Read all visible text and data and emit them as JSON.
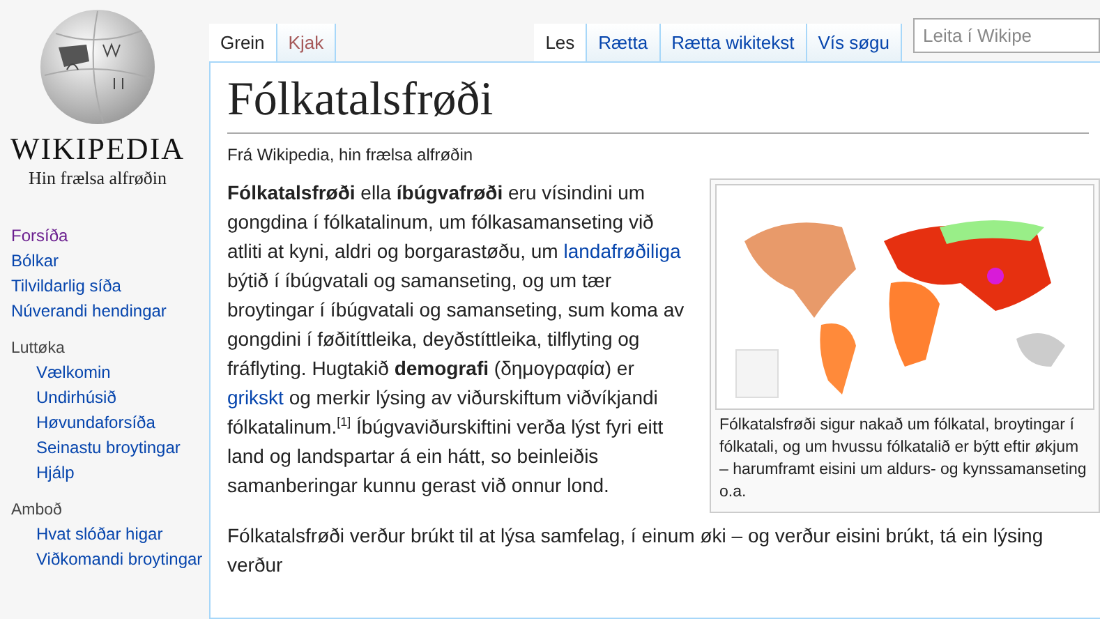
{
  "logo": {
    "wordmark": "WIKIPEDIA",
    "tagline": "Hin frælsa alfrøðin"
  },
  "sidebar": {
    "items": [
      {
        "label": "Forsíða",
        "visited": true
      },
      {
        "label": "Bólkar",
        "visited": false
      },
      {
        "label": "Tilvildarlig síða",
        "visited": false
      },
      {
        "label": "Núverandi hendingar",
        "visited": false
      }
    ],
    "sections": [
      {
        "heading": "Luttøka",
        "items": [
          {
            "label": "Vælkomin",
            "visited": false
          },
          {
            "label": "Undirhúsið",
            "visited": false
          },
          {
            "label": "Høvundaforsíða",
            "visited": false
          },
          {
            "label": "Seinastu broytingar",
            "visited": false
          },
          {
            "label": "Hjálp",
            "visited": false
          }
        ]
      },
      {
        "heading": "Amboð",
        "items": [
          {
            "label": "Hvat slóðar higar",
            "visited": false
          },
          {
            "label": "Viðkomandi broytingar",
            "visited": false
          }
        ]
      }
    ]
  },
  "tabs_left": [
    {
      "label": "Grein",
      "selected": true,
      "missing": false
    },
    {
      "label": "Kjak",
      "selected": false,
      "missing": true
    }
  ],
  "tabs_right": [
    {
      "label": "Les",
      "selected": true
    },
    {
      "label": "Rætta",
      "selected": false
    },
    {
      "label": "Rætta wikitekst",
      "selected": false
    },
    {
      "label": "Vís søgu",
      "selected": false
    }
  ],
  "search": {
    "placeholder": "Leita í Wikipe"
  },
  "article": {
    "title": "Fólkatalsfrøði",
    "subtitle": "Frá Wikipedia, hin frælsa alfrøðin",
    "intro": [
      {
        "kind": "text",
        "text": "**Fólkatalsfrøði** ella **íbúgvafrøði** eru vísindini um gongdina í fólkatalinum, um fólkasamanseting við atliti at kyni, aldri og borgarastøðu, um "
      },
      {
        "kind": "link",
        "text": "landafrøðiliga"
      },
      {
        "kind": "text",
        "text": " býtið í íbúgvatali og samanseting, og um tær broytingar í íbúgvatali og samanseting, sum koma av gongdini í føðitíttleika, deyðstíttleika, tilflyting og fráflyting. Hugtakið **demografi** (δημογραφία) er "
      },
      {
        "kind": "link",
        "text": "grikskt"
      },
      {
        "kind": "text",
        "text": " og merkir lýsing av viðurskiftum viðvíkjandi fólkatalinum.$^{[1]}$ Íbúgvaviðurskiftini verða lýst fyri eitt land og landspartar á ein hátt, so beinleiðis samanberingar kunnu gerast við onnur lond."
      }
    ],
    "paragraph_2": "Fólkatalsfrøði verður brúkt til at lýsa samfelag, í einum øki – og verður eisini brúkt, tá ein lýsing verður",
    "figure": {
      "caption": "Fólkatalsfrøði sigur nakað um fólkatal, broytingar í fólkatali, og um hvussu fólkatalið er býtt eftir økjum – harumframt eisini um aldurs- og kynssamanseting o.a."
    }
  }
}
